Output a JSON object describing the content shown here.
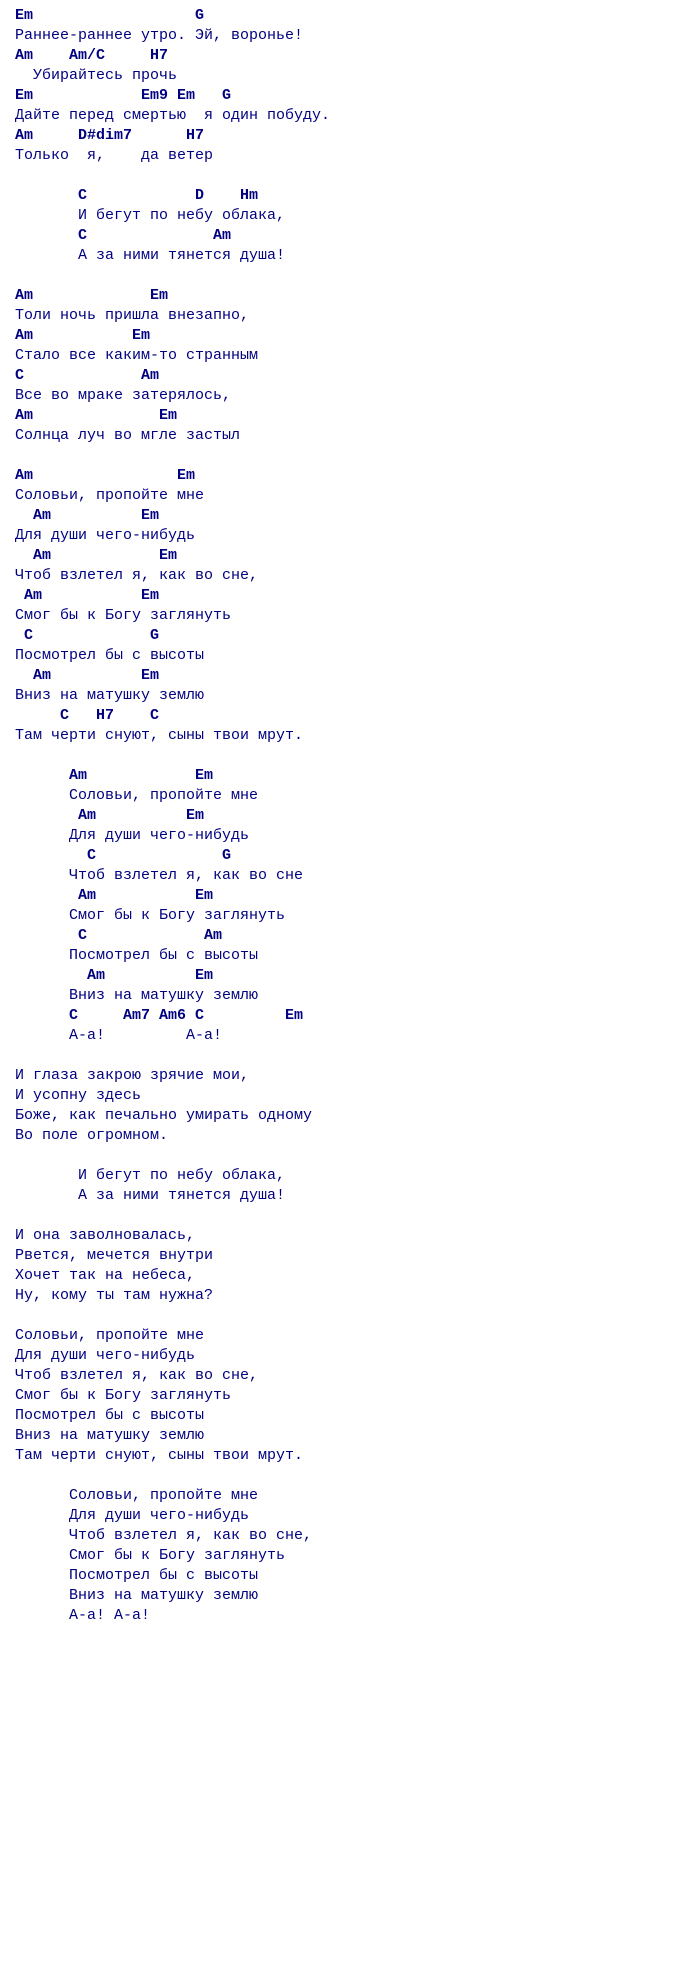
{
  "lines": [
    {
      "t": "chord",
      "text": "Em                  G"
    },
    {
      "t": "lyric",
      "text": "Раннее-раннее утро. Эй, воронье!"
    },
    {
      "t": "chord",
      "text": "Am    Am/C     H7"
    },
    {
      "t": "lyric",
      "text": "  Убирайтесь прочь"
    },
    {
      "t": "chord",
      "text": "Em            Em9 Em   G"
    },
    {
      "t": "lyric",
      "text": "Дайте перед смертью  я один побуду."
    },
    {
      "t": "chord",
      "text": "Am     D#dim7      H7"
    },
    {
      "t": "lyric",
      "text": "Только  я,    да ветер"
    },
    {
      "t": "lyric",
      "text": ""
    },
    {
      "t": "chord",
      "text": "       C            D    Hm"
    },
    {
      "t": "lyric",
      "text": "       И бегут по небу облака,"
    },
    {
      "t": "chord",
      "text": "       C              Am"
    },
    {
      "t": "lyric",
      "text": "       А за ними тянется душа!"
    },
    {
      "t": "lyric",
      "text": ""
    },
    {
      "t": "chord",
      "text": "Am             Em"
    },
    {
      "t": "lyric",
      "text": "Толи ночь пришла внезапно,"
    },
    {
      "t": "chord",
      "text": "Am           Em"
    },
    {
      "t": "lyric",
      "text": "Стало все каким-то странным"
    },
    {
      "t": "chord",
      "text": "C             Am"
    },
    {
      "t": "lyric",
      "text": "Все во мраке затерялось,"
    },
    {
      "t": "chord",
      "text": "Am              Em"
    },
    {
      "t": "lyric",
      "text": "Солнца луч во мгле застыл"
    },
    {
      "t": "lyric",
      "text": ""
    },
    {
      "t": "chord",
      "text": "Am                Em"
    },
    {
      "t": "lyric",
      "text": "Соловьи, пропойте мне"
    },
    {
      "t": "chord",
      "text": "  Am          Em"
    },
    {
      "t": "lyric",
      "text": "Для души чего-нибудь"
    },
    {
      "t": "chord",
      "text": "  Am            Em"
    },
    {
      "t": "lyric",
      "text": "Чтоб взлетел я, как во сне,"
    },
    {
      "t": "chord",
      "text": " Am           Em"
    },
    {
      "t": "lyric",
      "text": "Смог бы к Богу заглянуть"
    },
    {
      "t": "chord",
      "text": " C             G"
    },
    {
      "t": "lyric",
      "text": "Посмотрел бы с высоты"
    },
    {
      "t": "chord",
      "text": "  Am          Em"
    },
    {
      "t": "lyric",
      "text": "Вниз на матушку землю"
    },
    {
      "t": "chord",
      "text": "     C   H7    C"
    },
    {
      "t": "lyric",
      "text": "Там черти снуют, сыны твои мрут."
    },
    {
      "t": "lyric",
      "text": ""
    },
    {
      "t": "chord",
      "text": "      Am            Em"
    },
    {
      "t": "lyric",
      "text": "      Соловьи, пропойте мне"
    },
    {
      "t": "chord",
      "text": "       Am          Em"
    },
    {
      "t": "lyric",
      "text": "      Для души чего-нибудь"
    },
    {
      "t": "chord",
      "text": "        C              G"
    },
    {
      "t": "lyric",
      "text": "      Чтоб взлетел я, как во сне"
    },
    {
      "t": "chord",
      "text": "       Am           Em"
    },
    {
      "t": "lyric",
      "text": "      Смог бы к Богу заглянуть"
    },
    {
      "t": "chord",
      "text": "       C             Am"
    },
    {
      "t": "lyric",
      "text": "      Посмотрел бы с высоты"
    },
    {
      "t": "chord",
      "text": "        Am          Em"
    },
    {
      "t": "lyric",
      "text": "      Вниз на матушку землю"
    },
    {
      "t": "chord",
      "text": "      C     Am7 Am6 C         Em"
    },
    {
      "t": "lyric",
      "text": "      А-а!         А-а!"
    },
    {
      "t": "lyric",
      "text": ""
    },
    {
      "t": "lyric",
      "text": "И глаза закрою зрячие мои,"
    },
    {
      "t": "lyric",
      "text": "И усопну здесь"
    },
    {
      "t": "lyric",
      "text": "Боже, как печально умирать одному"
    },
    {
      "t": "lyric",
      "text": "Во поле огромном."
    },
    {
      "t": "lyric",
      "text": ""
    },
    {
      "t": "lyric",
      "text": "       И бегут по небу облака,"
    },
    {
      "t": "lyric",
      "text": "       А за ними тянется душа!"
    },
    {
      "t": "lyric",
      "text": ""
    },
    {
      "t": "lyric",
      "text": "И она заволновалась,"
    },
    {
      "t": "lyric",
      "text": "Рвется, мечется внутри"
    },
    {
      "t": "lyric",
      "text": "Хочет так на небеса,"
    },
    {
      "t": "lyric",
      "text": "Ну, кому ты там нужна?"
    },
    {
      "t": "lyric",
      "text": ""
    },
    {
      "t": "lyric",
      "text": "Соловьи, пропойте мне"
    },
    {
      "t": "lyric",
      "text": "Для души чего-нибудь"
    },
    {
      "t": "lyric",
      "text": "Чтоб взлетел я, как во сне,"
    },
    {
      "t": "lyric",
      "text": "Смог бы к Богу заглянуть"
    },
    {
      "t": "lyric",
      "text": "Посмотрел бы с высоты"
    },
    {
      "t": "lyric",
      "text": "Вниз на матушку землю"
    },
    {
      "t": "lyric",
      "text": "Там черти снуют, сыны твои мрут."
    },
    {
      "t": "lyric",
      "text": ""
    },
    {
      "t": "lyric",
      "text": "      Соловьи, пропойте мне"
    },
    {
      "t": "lyric",
      "text": "      Для души чего-нибудь"
    },
    {
      "t": "lyric",
      "text": "      Чтоб взлетел я, как во сне,"
    },
    {
      "t": "lyric",
      "text": "      Смог бы к Богу заглянуть"
    },
    {
      "t": "lyric",
      "text": "      Посмотрел бы с высоты"
    },
    {
      "t": "lyric",
      "text": "      Вниз на матушку землю"
    },
    {
      "t": "lyric",
      "text": "      А-а! А-а!"
    }
  ]
}
